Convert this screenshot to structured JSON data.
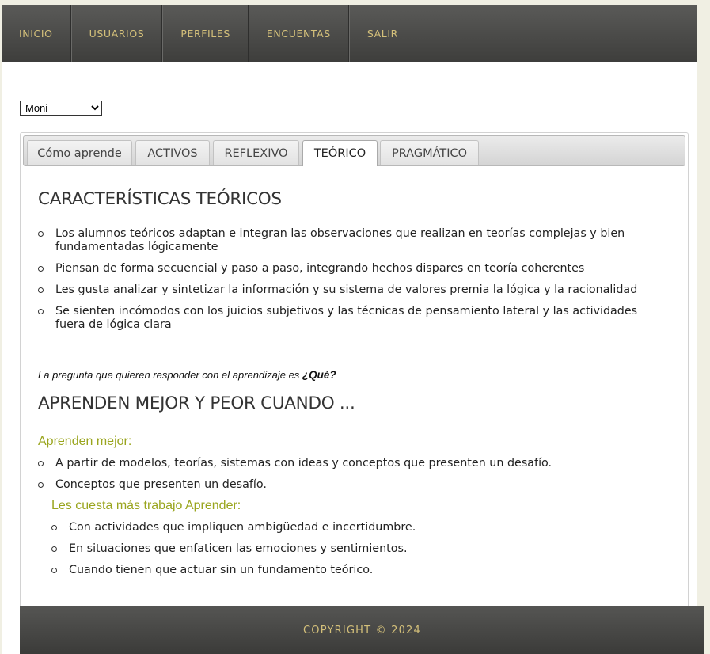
{
  "nav": {
    "items": [
      "INICIO",
      "USUARIOS",
      "PERFILES",
      "ENCUENTAS",
      "SALIR"
    ]
  },
  "user_select": {
    "value": "Moni"
  },
  "tabs": [
    {
      "label": "Cómo aprende",
      "active": false
    },
    {
      "label": "ACTIVOS",
      "active": false
    },
    {
      "label": "REFLEXIVO",
      "active": false
    },
    {
      "label": "TEÓRICO",
      "active": true
    },
    {
      "label": "PRAGMÁTICO",
      "active": false
    }
  ],
  "main": {
    "title": "CARACTERÍSTICAS TEÓRICOS",
    "characteristics": [
      "Los alumnos teóricos adaptan e integran las observaciones que realizan en teorías complejas y bien fundamentadas lógicamente",
      "Piensan de forma secuencial y paso a paso, integrando hechos dispares en teoría coherentes",
      "Les gusta analizar y sintetizar la información y su sistema de valores premia la lógica y la racionalidad",
      "Se sienten incómodos con los juicios subjetivos y las técnicas de pensamiento lateral y las actividades fuera de lógica clara"
    ],
    "question_text": "La pregunta que quieren responder con el aprendizaje es ",
    "question_answer": "¿Qué?",
    "subtitle": "APRENDEN MEJOR Y PEOR CUANDO ...",
    "better_heading": "Aprenden mejor:",
    "better_items": [
      "A partir de modelos, teorías, sistemas con ideas y conceptos que presenten un desafío.",
      "Conceptos que presenten un desafío."
    ],
    "worse_heading": "Les cuesta más trabajo Aprender:",
    "worse_items": [
      "Con actividades que impliquen ambigüedad e incertidumbre.",
      "En situaciones que enfaticen las emociones y sentimientos.",
      "Cuando tienen que actuar sin un fundamento teórico."
    ]
  },
  "footer": {
    "text": "COPYRIGHT © 2024"
  },
  "colors": {
    "nav_bg": "#4a4a48",
    "nav_text": "#d4c07a",
    "green_heading": "#9aa51e",
    "page_bg": "#f0efe3"
  }
}
